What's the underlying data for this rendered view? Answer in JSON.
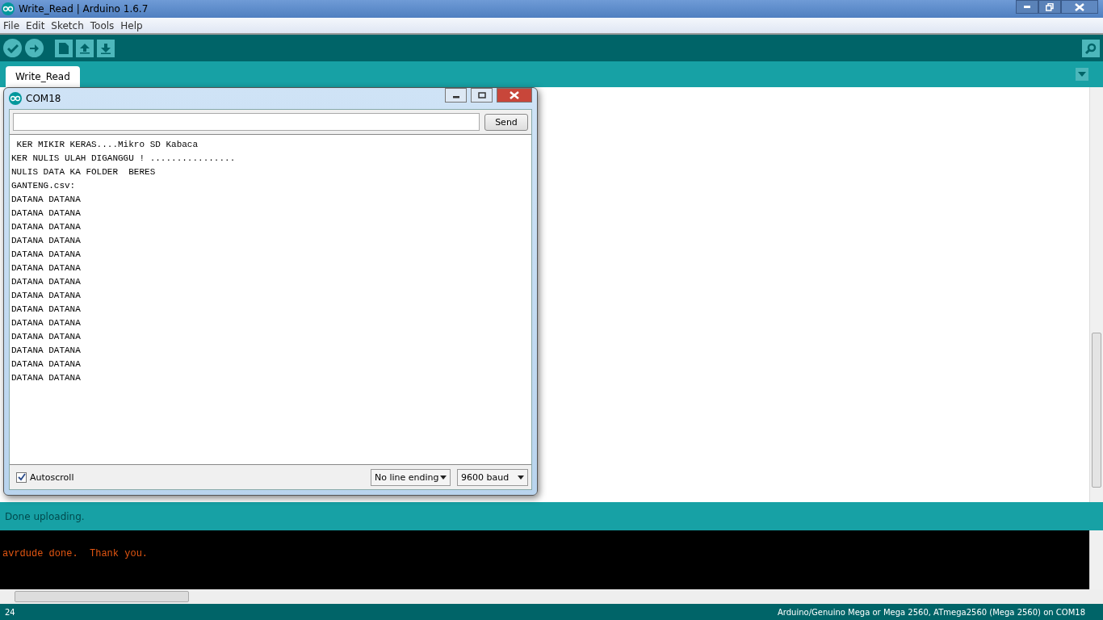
{
  "window": {
    "title": "Write_Read | Arduino 1.6.7"
  },
  "menu": [
    "File",
    "Edit",
    "Sketch",
    "Tools",
    "Help"
  ],
  "tabs": [
    {
      "label": "Write_Read",
      "selected": true
    }
  ],
  "status": "Done uploading.",
  "console": [
    "avrdude done.  Thank you."
  ],
  "line_number": "24",
  "board": "Arduino/Genuino Mega or Mega 2560, ATmega2560 (Mega 2560) on COM18",
  "serial_monitor": {
    "title": "COM18",
    "send_button": "Send",
    "output": [
      " KER MIKIR KERAS....Mikro SD Kabaca",
      "KER NULIS ULAH DIGANGGU ! ................",
      "NULIS DATA KA FOLDER  BERES",
      "GANTENG.csv:",
      "DATANA DATANA",
      "DATANA DATANA",
      "DATANA DATANA",
      "DATANA DATANA",
      "DATANA DATANA",
      "DATANA DATANA",
      "DATANA DATANA",
      "DATANA DATANA",
      "DATANA DATANA",
      "DATANA DATANA",
      "DATANA DATANA",
      "DATANA DATANA",
      "DATANA DATANA",
      "DATANA DATANA"
    ],
    "autoscroll": {
      "label": "Autoscroll",
      "checked": true
    },
    "line_ending": "No line ending",
    "baud": "9600 baud"
  }
}
